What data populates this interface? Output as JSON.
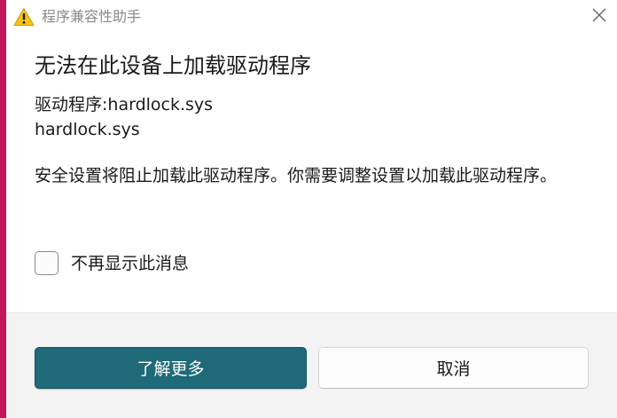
{
  "window": {
    "title": "程序兼容性助手"
  },
  "dialog": {
    "heading": "无法在此设备上加载驱动程序",
    "driver_label": "驱动程序:hardlock.sys",
    "driver_file": "hardlock.sys",
    "message": "安全设置将阻止加载此驱动程序。你需要调整设置以加载此驱动程序。",
    "checkbox_label": "不再显示此消息",
    "checkbox_checked": false
  },
  "buttons": {
    "learn_more": "了解更多",
    "cancel": "取消"
  },
  "icons": {
    "title": "warning-icon",
    "close": "close-icon"
  },
  "colors": {
    "primary_button": "#1e6a78",
    "warning_yellow": "#f5c518"
  }
}
